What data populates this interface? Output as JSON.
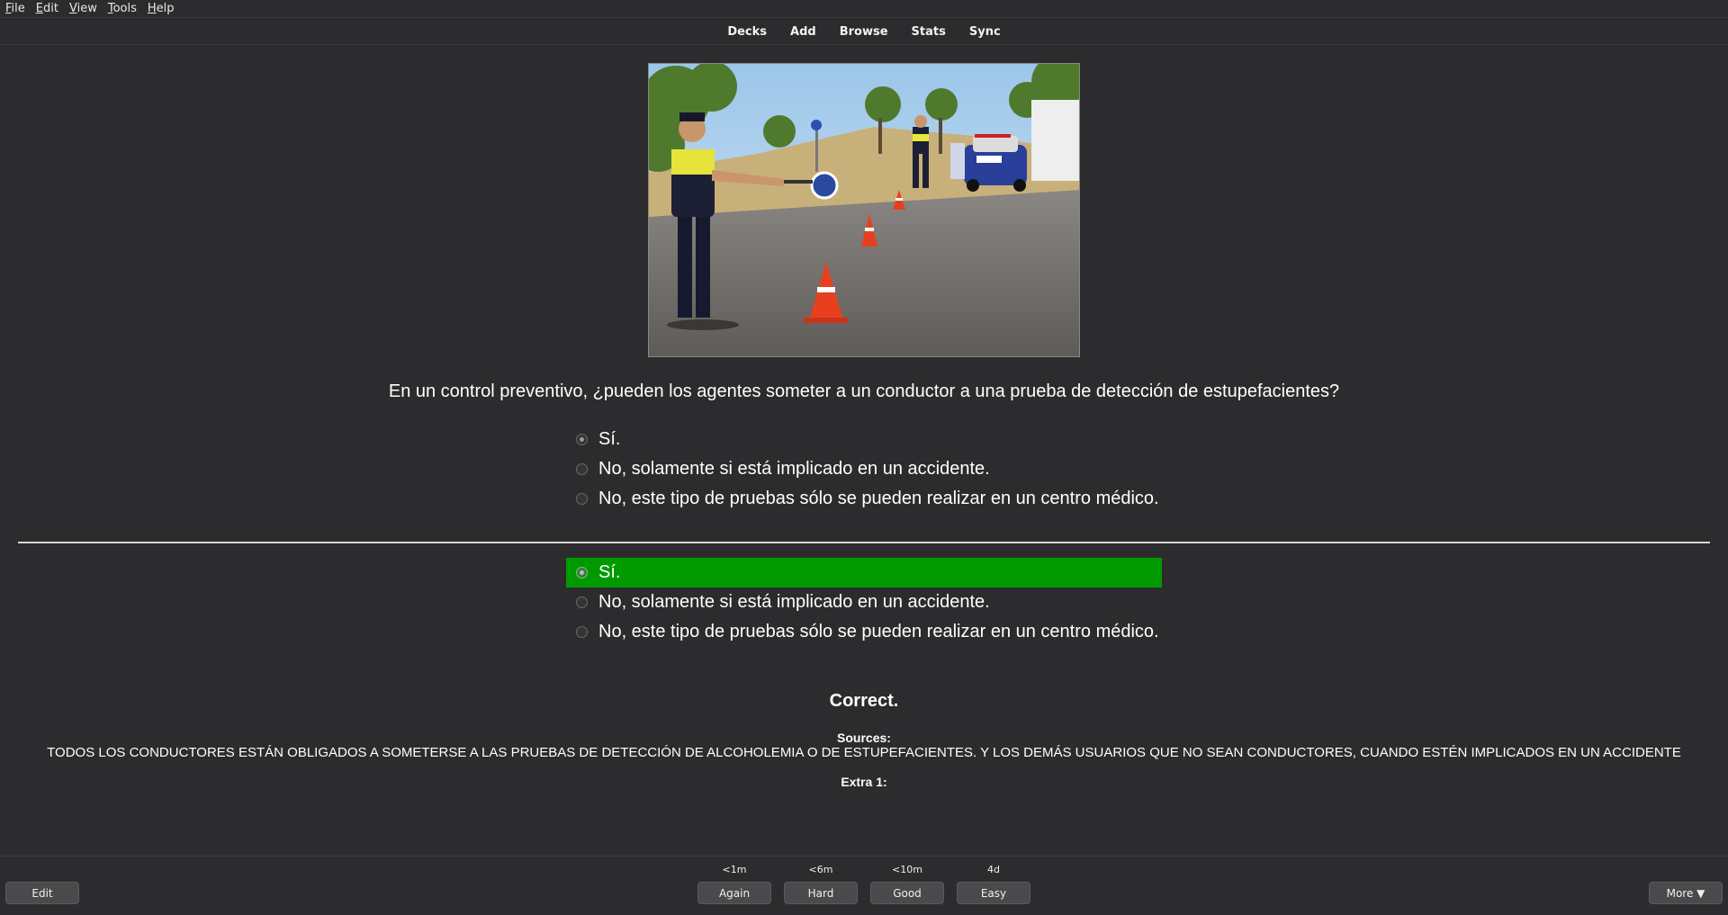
{
  "menubar": {
    "items": [
      {
        "label": "File",
        "accel": "F",
        "rest": "ile"
      },
      {
        "label": "Edit",
        "accel": "E",
        "rest": "dit"
      },
      {
        "label": "View",
        "accel": "V",
        "rest": "iew"
      },
      {
        "label": "Tools",
        "accel": "T",
        "rest": "ools"
      },
      {
        "label": "Help",
        "accel": "H",
        "rest": "elp"
      }
    ]
  },
  "toolbar": {
    "decks": "Decks",
    "add": "Add",
    "browse": "Browse",
    "stats": "Stats",
    "sync": "Sync"
  },
  "card": {
    "question": "En un control preventivo, ¿pueden los agentes someter a un conductor a una prueba de detección de estupefacientes?",
    "front_options": [
      {
        "label": "Sí.",
        "selected": true
      },
      {
        "label": "No, solamente si está implicado en un accidente.",
        "selected": false
      },
      {
        "label": "No, este tipo de pruebas sólo se pueden realizar en un centro médico.",
        "selected": false
      }
    ],
    "back_options": [
      {
        "label": "Sí.",
        "selected": true,
        "correct": true
      },
      {
        "label": "No, solamente si está implicado en un accidente.",
        "selected": false,
        "correct": false
      },
      {
        "label": "No, este tipo de pruebas sólo se pueden realizar en un centro médico.",
        "selected": false,
        "correct": false
      }
    ],
    "result": "Correct.",
    "sources_label": "Sources:",
    "sources_text": "TODOS LOS CONDUCTORES ESTÁN OBLIGADOS A SOMETERSE A LAS PRUEBAS DE DETECCIÓN DE ALCOHOLEMIA O DE ESTUPEFACIENTES. Y LOS DEMÁS USUARIOS QUE NO SEAN CONDUCTORES, CUANDO ESTÉN IMPLICADOS EN UN ACCIDENTE",
    "extra_label": "Extra 1:",
    "correct_color": "#009a00"
  },
  "bottombar": {
    "edit": "Edit",
    "more": "More ▼",
    "answers": [
      {
        "interval": "<1m",
        "label": "Again"
      },
      {
        "interval": "<6m",
        "label": "Hard"
      },
      {
        "interval": "<10m",
        "label": "Good"
      },
      {
        "interval": "4d",
        "label": "Easy"
      }
    ]
  }
}
